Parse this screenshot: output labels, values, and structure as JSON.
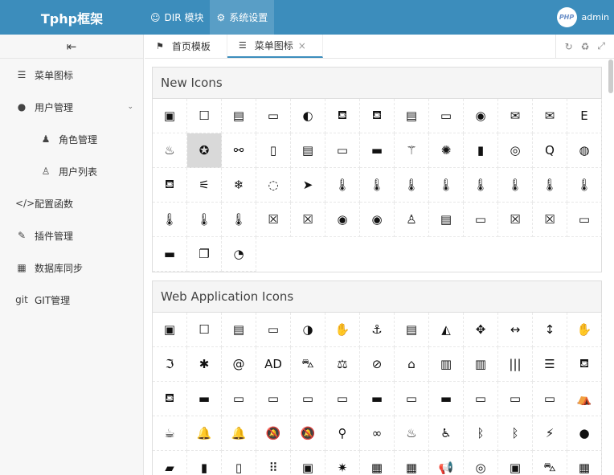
{
  "app": {
    "title": "Tphp框架",
    "nav": [
      {
        "icon": "smile-icon",
        "glyph": "☺",
        "label": "DIR 模块",
        "active": false
      },
      {
        "icon": "gear-icon",
        "glyph": "⚙",
        "label": "系统设置",
        "active": true
      }
    ],
    "user": {
      "avatar_text": "PHP",
      "name": "admin"
    }
  },
  "sidebar": {
    "toggle_glyph": "⇤",
    "items": [
      {
        "name": "sidebar-item-menu-icons",
        "icon": "bars-icon",
        "glyph": "☰",
        "label": "菜单图标",
        "sub": false,
        "arrow": ""
      },
      {
        "name": "sidebar-item-user-manage",
        "icon": "user-icon",
        "glyph": "●",
        "label": "用户管理",
        "sub": false,
        "arrow": "⌄"
      },
      {
        "name": "sidebar-item-role-manage",
        "icon": "male-icon",
        "glyph": "♟",
        "label": "角色管理",
        "sub": true,
        "arrow": ""
      },
      {
        "name": "sidebar-item-user-list",
        "icon": "user-outline-icon",
        "glyph": "♙",
        "label": "用户列表",
        "sub": true,
        "arrow": ""
      },
      {
        "name": "sidebar-item-config-func",
        "icon": "code-icon",
        "glyph": "</>",
        "label": "配置函数",
        "sub": false,
        "arrow": ""
      },
      {
        "name": "sidebar-item-plugin-manage",
        "icon": "plug-icon",
        "glyph": "✎",
        "label": "插件管理",
        "sub": false,
        "arrow": ""
      },
      {
        "name": "sidebar-item-db-sync",
        "icon": "table-icon",
        "glyph": "▦",
        "label": "数据库同步",
        "sub": false,
        "arrow": ""
      },
      {
        "name": "sidebar-item-git-manage",
        "icon": "git-icon",
        "glyph": "git",
        "label": "GIT管理",
        "sub": false,
        "arrow": ""
      }
    ]
  },
  "tabs": {
    "items": [
      {
        "icon": "flag-icon",
        "glyph": "⚑",
        "label": "首页模板",
        "active": false,
        "closable": false
      },
      {
        "icon": "bars-icon",
        "glyph": "☰",
        "label": "菜单图标",
        "active": true,
        "closable": true
      }
    ],
    "close_glyph": "×",
    "tools": [
      {
        "icon": "refresh-icon",
        "glyph": "↻"
      },
      {
        "icon": "recycle-icon",
        "glyph": "♻"
      },
      {
        "icon": "expand-icon",
        "glyph": "⤢"
      }
    ]
  },
  "panels": [
    {
      "title": "New Icons",
      "icons": [
        [
          "address-book-icon",
          "▣"
        ],
        [
          "address-book-o-icon",
          "☐"
        ],
        [
          "address-card-icon",
          "▤"
        ],
        [
          "address-card-o-icon",
          "▭"
        ],
        [
          "bandcamp-icon",
          "◐"
        ],
        [
          "bath-icon",
          "⛾"
        ],
        [
          "bathtub-icon",
          "⛾"
        ],
        [
          "drivers-license-icon",
          "▤"
        ],
        [
          "drivers-license-o-icon",
          "▭"
        ],
        [
          "eercast-icon",
          "◉"
        ],
        [
          "envelope-open-icon",
          "✉"
        ],
        [
          "envelope-open-o-icon",
          "✉"
        ],
        [
          "etsy-icon",
          "E"
        ],
        [
          "free-code-camp-icon",
          "♨"
        ],
        [
          "grav-icon",
          "✪"
        ],
        [
          "handshake-o-icon",
          "⚯"
        ],
        [
          "id-badge-icon",
          "▯"
        ],
        [
          "id-card-icon",
          "▤"
        ],
        [
          "id-card-o-icon",
          "▭"
        ],
        [
          "imdb-icon",
          "▬"
        ],
        [
          "linode-icon",
          "⚚"
        ],
        [
          "meetup-icon",
          "✺"
        ],
        [
          "microchip-icon",
          "▮"
        ],
        [
          "podcast-icon",
          "◎"
        ],
        [
          "quora-icon",
          "Q"
        ],
        [
          "ravelry-icon",
          "◍"
        ],
        [
          "s15-icon",
          "⛾"
        ],
        [
          "shower-icon",
          "⚟"
        ],
        [
          "snowflake-o-icon",
          "❄"
        ],
        [
          "superpowers-icon",
          "◌"
        ],
        [
          "telegram-icon",
          "➤"
        ],
        [
          "thermometer-icon",
          "🌡"
        ],
        [
          "thermometer-0-icon",
          "🌡"
        ],
        [
          "thermometer-1-icon",
          "🌡"
        ],
        [
          "thermometer-2-icon",
          "🌡"
        ],
        [
          "thermometer-3-icon",
          "🌡"
        ],
        [
          "thermometer-4-icon",
          "🌡"
        ],
        [
          "thermometer-empty-icon",
          "🌡"
        ],
        [
          "thermometer-full-icon",
          "🌡"
        ],
        [
          "thermometer-half-icon",
          "🌡"
        ],
        [
          "thermometer-quarter-icon",
          "🌡"
        ],
        [
          "thermometer-three-quarters-icon",
          "🌡"
        ],
        [
          "times-rectangle-icon",
          "☒"
        ],
        [
          "times-rectangle-o-icon",
          "☒"
        ],
        [
          "user-circle-icon",
          "◉"
        ],
        [
          "user-circle-o-icon",
          "◉"
        ],
        [
          "user-o-icon",
          "♙"
        ],
        [
          "vcard-icon",
          "▤"
        ],
        [
          "vcard-o-icon",
          "▭"
        ],
        [
          "window-close-icon",
          "☒"
        ],
        [
          "window-close-o-icon",
          "☒"
        ],
        [
          "window-maximize-icon",
          "▭"
        ],
        [
          "window-minimize-icon",
          "▬"
        ],
        [
          "window-restore-icon",
          "❐"
        ],
        [
          "wpexplorer-icon",
          "◔"
        ]
      ]
    },
    {
      "title": "Web Application Icons",
      "icons": [
        [
          "address-book-icon",
          "▣"
        ],
        [
          "address-book-o-icon",
          "☐"
        ],
        [
          "address-card-icon",
          "▤"
        ],
        [
          "address-card-o-icon",
          "▭"
        ],
        [
          "adjust-icon",
          "◑"
        ],
        [
          "american-sign-language-icon",
          "✋"
        ],
        [
          "anchor-icon",
          "⚓"
        ],
        [
          "archive-icon",
          "▤"
        ],
        [
          "area-chart-icon",
          "◭"
        ],
        [
          "arrows-icon",
          "✥"
        ],
        [
          "arrows-h-icon",
          "↔"
        ],
        [
          "arrows-v-icon",
          "↕"
        ],
        [
          "asl-interpreting-icon",
          "✋"
        ],
        [
          "assistive-listening-icon",
          "ℑ"
        ],
        [
          "asterisk-icon",
          "✱"
        ],
        [
          "at-icon",
          "@"
        ],
        [
          "audio-description-icon",
          "AD"
        ],
        [
          "automobile-icon",
          "⛍"
        ],
        [
          "balance-scale-icon",
          "⚖"
        ],
        [
          "ban-icon",
          "⊘"
        ],
        [
          "bank-icon",
          "⌂"
        ],
        [
          "bar-chart-icon",
          "▥"
        ],
        [
          "bar-chart-o-icon",
          "▥"
        ],
        [
          "barcode-icon",
          "|||"
        ],
        [
          "bars-icon",
          "☰"
        ],
        [
          "bath-icon",
          "⛾"
        ],
        [
          "bathtub-icon",
          "⛾"
        ],
        [
          "battery-icon",
          "▬"
        ],
        [
          "battery-0-icon",
          "▭"
        ],
        [
          "battery-1-icon",
          "▭"
        ],
        [
          "battery-2-icon",
          "▭"
        ],
        [
          "battery-3-icon",
          "▭"
        ],
        [
          "battery-4-icon",
          "▬"
        ],
        [
          "battery-empty-icon",
          "▭"
        ],
        [
          "battery-full-icon",
          "▬"
        ],
        [
          "battery-half-icon",
          "▭"
        ],
        [
          "battery-quarter-icon",
          "▭"
        ],
        [
          "battery-three-quarters-icon",
          "▭"
        ],
        [
          "bed-icon",
          "⛺"
        ],
        [
          "beer-icon",
          "☕"
        ],
        [
          "bell-icon",
          "🔔"
        ],
        [
          "bell-o-icon",
          "🔔"
        ],
        [
          "bell-slash-icon",
          "🔕"
        ],
        [
          "bell-slash-o-icon",
          "🔕"
        ],
        [
          "bicycle-icon",
          "⚲"
        ],
        [
          "binoculars-icon",
          "∞"
        ],
        [
          "birthday-cake-icon",
          "♨"
        ],
        [
          "blind-icon",
          "♿"
        ],
        [
          "bluetooth-icon",
          "ᛒ"
        ],
        [
          "bluetooth-b-icon",
          "ᛒ"
        ],
        [
          "bolt-icon",
          "⚡"
        ],
        [
          "bomb-icon",
          "●"
        ],
        [
          "book-icon",
          "▰"
        ],
        [
          "bookmark-icon",
          "▮"
        ],
        [
          "bookmark-o-icon",
          "▯"
        ],
        [
          "braille-icon",
          "⠿"
        ],
        [
          "briefcase-icon",
          "▣"
        ],
        [
          "bug-icon",
          "✷"
        ],
        [
          "building-icon",
          "▦"
        ],
        [
          "building-o-icon",
          "▦"
        ],
        [
          "bullhorn-icon",
          "📢"
        ],
        [
          "bullseye-icon",
          "◎"
        ],
        [
          "bus-icon",
          "▣"
        ],
        [
          "cab-icon",
          "⛍"
        ],
        [
          "calculator-icon",
          "▦"
        ]
      ]
    }
  ]
}
